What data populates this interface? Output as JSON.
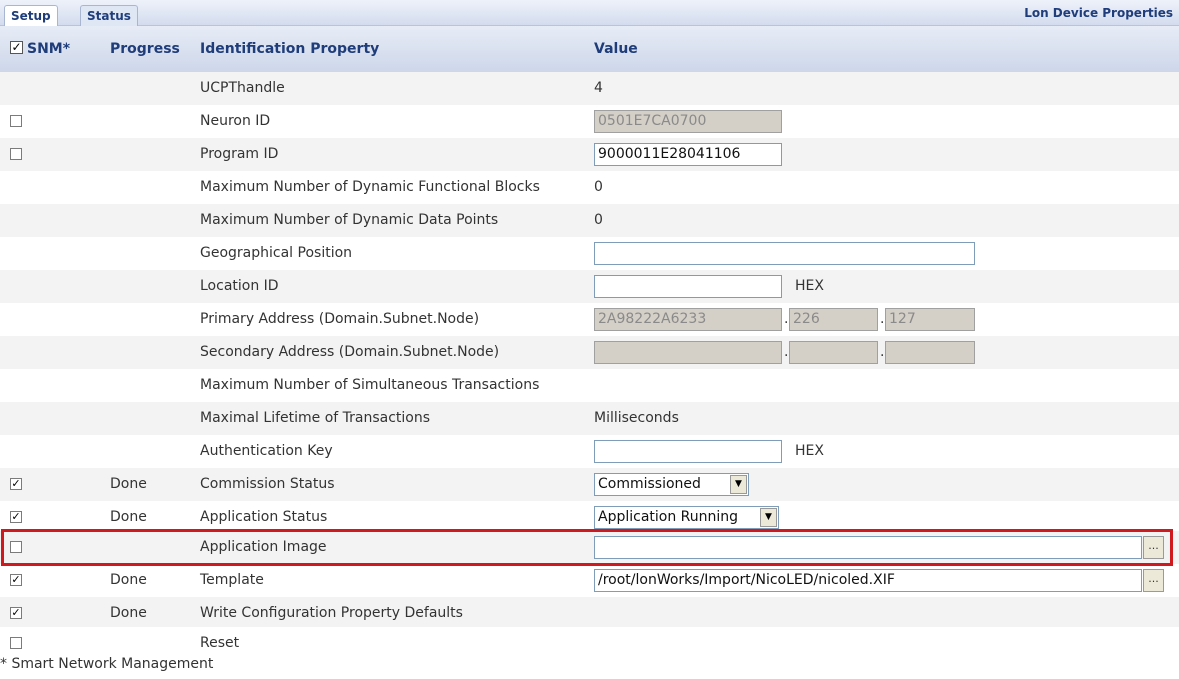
{
  "tabs": [
    {
      "label": "Setup"
    },
    {
      "label": "Status"
    }
  ],
  "page_title": "Lon Device Properties",
  "header": {
    "snm_check": "✓",
    "snm": "SNM*",
    "progress": "Progress",
    "property": "Identification Property",
    "value": "Value"
  },
  "check_mark": "✓",
  "rows": {
    "ucpt": {
      "property": "UCPThandle",
      "value": "4"
    },
    "neuron": {
      "property": "Neuron ID",
      "value": "0501E7CA0700"
    },
    "program": {
      "property": "Program ID",
      "value": "9000011E28041106"
    },
    "maxfb": {
      "property": "Maximum Number of Dynamic Functional Blocks",
      "value": "0"
    },
    "maxdp": {
      "property": "Maximum Number of Dynamic Data Points",
      "value": "0"
    },
    "geo": {
      "property": "Geographical Position",
      "value": ""
    },
    "loc": {
      "property": "Location ID",
      "value": "",
      "unit": "HEX"
    },
    "primary": {
      "property": "Primary Address (Domain.Subnet.Node)",
      "domain": "2A98222A6233",
      "subnet": "226",
      "node": "127",
      "separator": "."
    },
    "secondary": {
      "property": "Secondary Address (Domain.Subnet.Node)",
      "domain": "",
      "subnet": "",
      "node": "",
      "separator": "."
    },
    "maxtx": {
      "property": "Maximum Number of Simultaneous Transactions"
    },
    "lifetime": {
      "property": "Maximal Lifetime of Transactions",
      "value": "Milliseconds"
    },
    "auth": {
      "property": "Authentication Key",
      "value": "",
      "unit": "HEX"
    },
    "commission": {
      "progress": "Done",
      "property": "Commission Status",
      "selected": "Commissioned"
    },
    "appstatus": {
      "progress": "Done",
      "property": "Application Status",
      "selected": "Application Running"
    },
    "appimage": {
      "property": "Application Image",
      "value": ""
    },
    "template": {
      "progress": "Done",
      "property": "Template",
      "value": "/root/lonWorks/Import/NicoLED/nicoled.XIF"
    },
    "writecp": {
      "progress": "Done",
      "property": "Write Configuration Property Defaults"
    },
    "reset": {
      "property": "Reset"
    }
  },
  "browse_label": "...",
  "select_arrow": "▼",
  "footnote": "* Smart Network Management"
}
